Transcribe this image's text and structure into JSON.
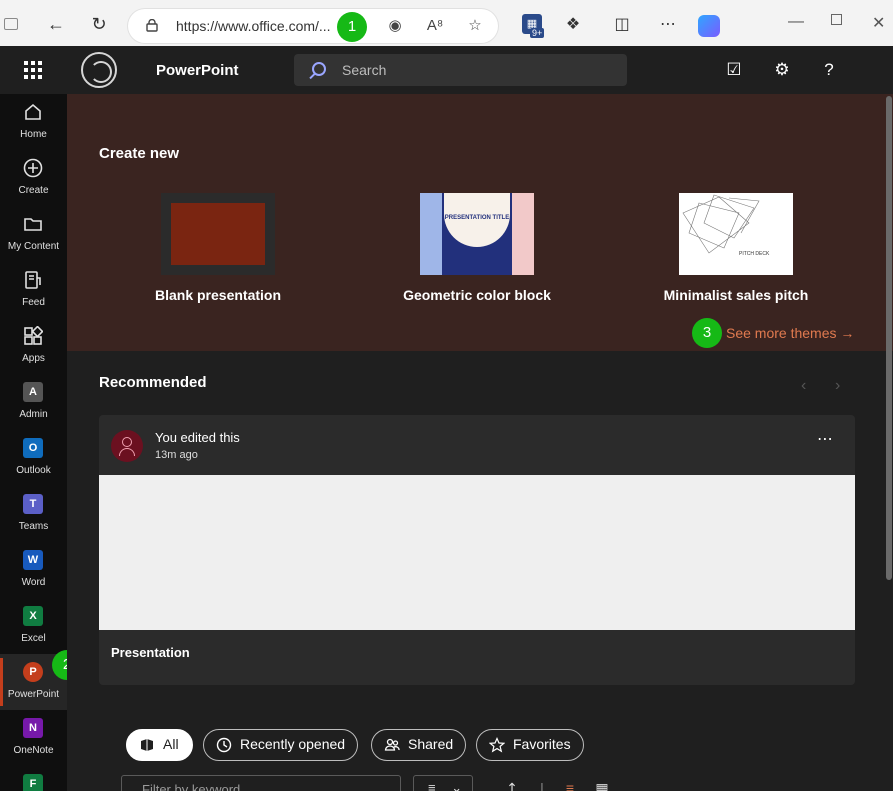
{
  "browser": {
    "url": "https://www.office.com/...",
    "extensions_badge": "9+"
  },
  "annotations": {
    "badge1": "1",
    "badge2": "2",
    "badge3": "3"
  },
  "header": {
    "app_name": "PowerPoint",
    "search_placeholder": "Search"
  },
  "rail": {
    "items": [
      {
        "label": "Home"
      },
      {
        "label": "Create"
      },
      {
        "label": "My Content"
      },
      {
        "label": "Feed"
      },
      {
        "label": "Apps"
      },
      {
        "label": "Admin"
      },
      {
        "label": "Outlook",
        "letter": "O",
        "color": "#0f6cbd"
      },
      {
        "label": "Teams",
        "letter": "T",
        "color": "#5b5fc7"
      },
      {
        "label": "Word",
        "letter": "W",
        "color": "#185abd"
      },
      {
        "label": "Excel",
        "letter": "X",
        "color": "#107c41"
      },
      {
        "label": "PowerPoint",
        "letter": "P",
        "color": "#c43e1c"
      },
      {
        "label": "OneNote",
        "letter": "N",
        "color": "#7719aa"
      }
    ]
  },
  "create_new": {
    "title": "Create new",
    "templates": [
      {
        "name": "Blank presentation"
      },
      {
        "name": "Geometric color block",
        "thumb_title": "PRESENTATION TITLE"
      },
      {
        "name": "Minimalist sales pitch",
        "thumb_title": "PITCH DECK"
      }
    ],
    "see_more": "See more themes →"
  },
  "recommended": {
    "title": "Recommended",
    "card": {
      "activity": "You edited this",
      "time": "13m ago",
      "file_title": "Presentation"
    }
  },
  "filters": {
    "pills": [
      {
        "label": "All",
        "active": true
      },
      {
        "label": "Recently opened"
      },
      {
        "label": "Shared"
      },
      {
        "label": "Favorites"
      }
    ],
    "keyword_placeholder": "Filter by keyword"
  },
  "colors": {
    "accent": "#c43e1c",
    "link": "#e07a4f",
    "banner": "#3a2420",
    "badge": "#16b916"
  }
}
